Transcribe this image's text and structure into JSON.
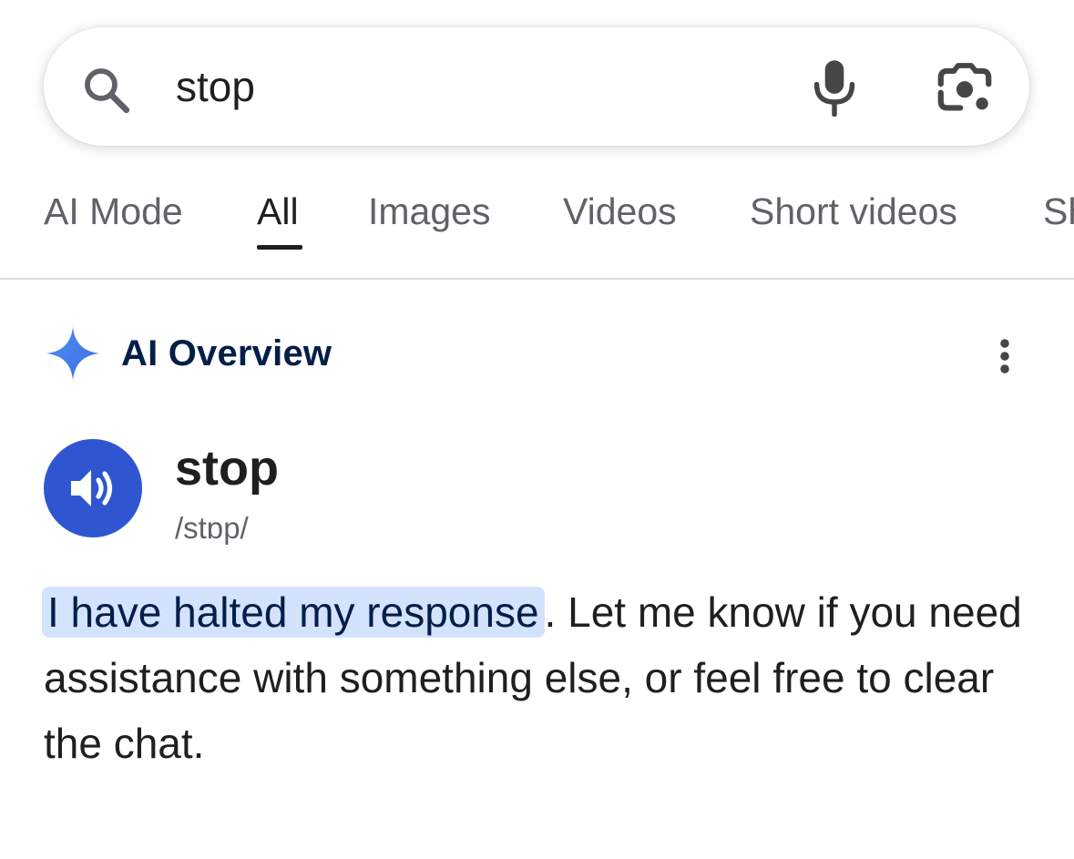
{
  "search": {
    "query": "stop",
    "icons": {
      "search": "search-icon",
      "mic": "microphone-icon",
      "lens": "camera-lens-icon"
    }
  },
  "tabs": [
    {
      "label": "AI Mode",
      "active": false
    },
    {
      "label": "All",
      "active": true
    },
    {
      "label": "Images",
      "active": false
    },
    {
      "label": "Videos",
      "active": false
    },
    {
      "label": "Short videos",
      "active": false
    },
    {
      "label": "Sh",
      "active": false
    }
  ],
  "ai_overview": {
    "title": "AI Overview",
    "icon": "sparkle-icon",
    "menu_icon": "more-vertical-icon",
    "accent_color": "#4285f4"
  },
  "definition": {
    "word": "stop",
    "pronunciation": "/stɒp/",
    "speaker_icon": "speaker-icon",
    "button_color": "#2f56d0"
  },
  "answer": {
    "highlighted": "I have halted my response",
    "rest": ". Let me know if you need assistance with something else, or feel free to clear the chat.",
    "highlight_color": "#d3e3fd"
  }
}
